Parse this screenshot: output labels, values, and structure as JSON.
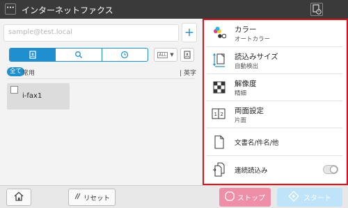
{
  "header": {
    "title": "インターネットファクス",
    "menu_label": "···"
  },
  "address": {
    "placeholder": "sample@test.local"
  },
  "add_label": "+",
  "filter": {
    "all_label": "全て",
    "frequent_label": "常用",
    "alpha_label": "英字"
  },
  "dropdown": {
    "tag": "ALL",
    "arrow": "▼"
  },
  "destinations": [
    {
      "label": "i-fax1"
    }
  ],
  "settings": [
    {
      "title": "カラー",
      "value": "オートカラー",
      "icon": "color-icon"
    },
    {
      "title": "読込みサイズ",
      "value": "自動検出",
      "icon": "scan-size-icon"
    },
    {
      "title": "解像度",
      "value": "精細",
      "icon": "resolution-icon"
    },
    {
      "title": "両面設定",
      "value": "片面",
      "icon": "duplex-icon"
    },
    {
      "title": "文書名/件名/他",
      "icon": "document-icon"
    },
    {
      "title": "連続読込み",
      "icon": "continuous-scan-icon",
      "toggle": false
    }
  ],
  "footer": {
    "reset_label": "リセット",
    "stop_label": "ストップ",
    "start_label": "スタート"
  },
  "colors": {
    "accent": "#1f8fd0",
    "highlight_border": "#e0101a",
    "stop": "#ef8fa7",
    "start": "#bfe3f8"
  }
}
